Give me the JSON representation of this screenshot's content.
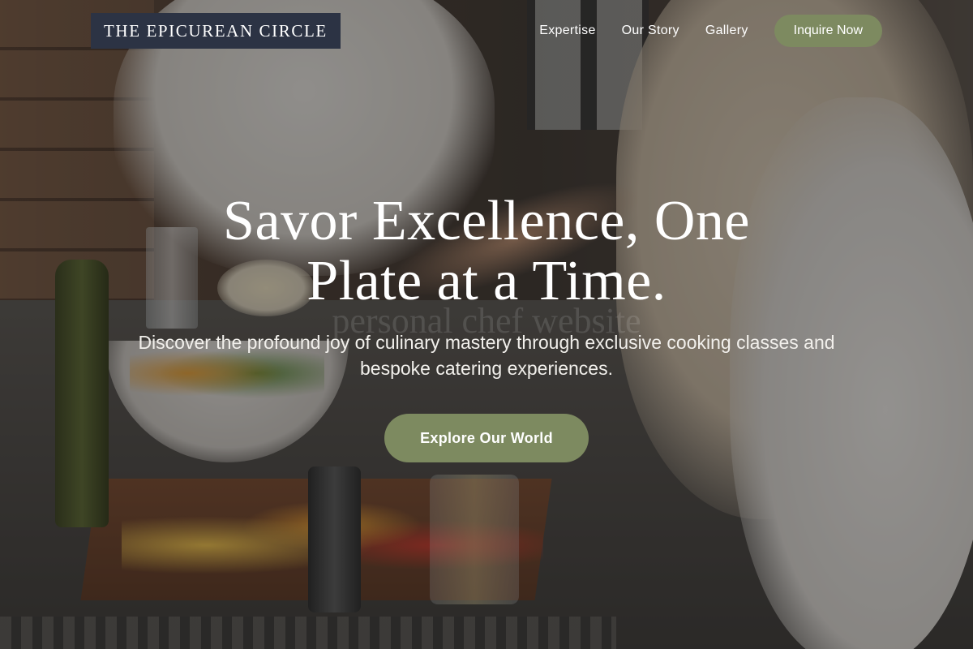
{
  "nav": {
    "brand": "THE EPICUREAN CIRCLE",
    "links": [
      {
        "label": "Expertise"
      },
      {
        "label": "Our Story"
      },
      {
        "label": "Gallery"
      }
    ],
    "cta_label": "Inquire Now"
  },
  "hero": {
    "headline": "Savor Excellence, One Plate at a Time.",
    "subheadline": "Discover the profound joy of culinary mastery through exclusive cooking classes and bespoke catering experiences.",
    "cta_label": "Explore Our World",
    "background_watermark": "personal chef website"
  },
  "colors": {
    "accent": "#7d8a60",
    "brand_box": "#2c3344",
    "text": "#ffffff"
  }
}
